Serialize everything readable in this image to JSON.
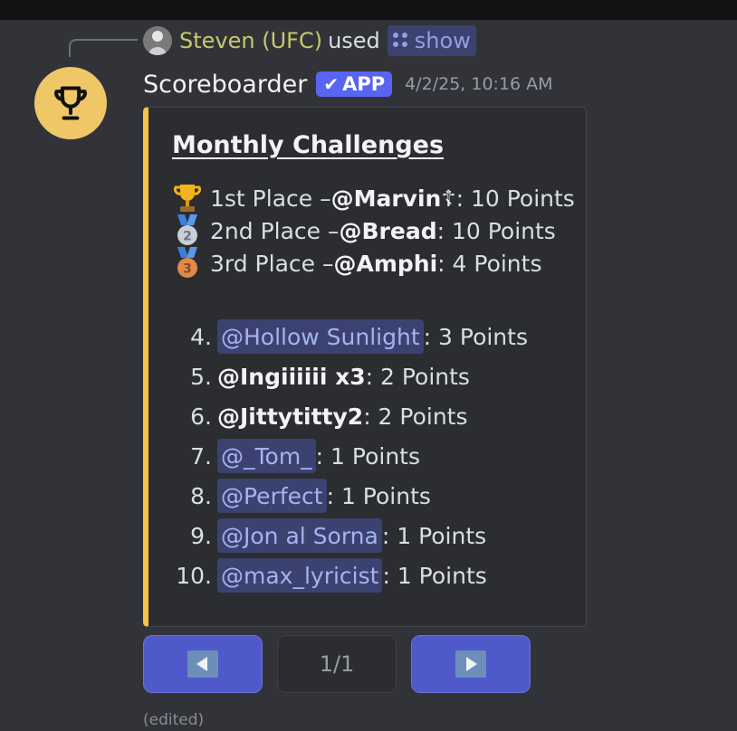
{
  "reply": {
    "user_name": "Steven (UFC)",
    "used_text": "used",
    "command": "show"
  },
  "message": {
    "bot_name": "Scoreboarder",
    "badge": "APP",
    "timestamp": "4/2/25, 10:16 AM",
    "avatar_icon": "trophy-icon",
    "avatar_color": "#f0c767",
    "edited_label": "(edited)"
  },
  "embed": {
    "accent_color": "#f3c445",
    "title": "Monthly Challenges",
    "podium": [
      {
        "medal": "trophy-icon",
        "place": "1st Place – ",
        "user": "@Marvin",
        "user_suffix": "☦",
        "points": ": 10 Points"
      },
      {
        "medal": "second-place-medal-icon",
        "place": "2nd Place – ",
        "user": "@Bread",
        "user_suffix": "",
        "points": ": 10 Points"
      },
      {
        "medal": "third-place-medal-icon",
        "place": "3rd Place – ",
        "user": "@Amphi",
        "user_suffix": "",
        "points": ": 4 Points"
      }
    ],
    "ranks": [
      {
        "num": "4.",
        "user": "@Hollow Sunlight",
        "points": ": 3 Points",
        "style": "mention"
      },
      {
        "num": "5.",
        "user": "@Ingiiiiii x3",
        "points": ": 2 Points",
        "style": "bold"
      },
      {
        "num": "6.",
        "user": "@Jittytitty2",
        "points": ": 2 Points",
        "style": "bold"
      },
      {
        "num": "7.",
        "user": "@_Tom_",
        "points": ": 1 Points",
        "style": "mention"
      },
      {
        "num": "8.",
        "user": "@Perfect",
        "points": ": 1 Points",
        "style": "mention"
      },
      {
        "num": "9.",
        "user": "@Jon al Sorna",
        "points": ": 1 Points",
        "style": "mention"
      },
      {
        "num": "10.",
        "user": "@max_lyricist",
        "points": ": 1 Points",
        "style": "mention"
      }
    ]
  },
  "pagination": {
    "prev_icon": "previous-arrow-icon",
    "page_label": "1/1",
    "next_icon": "next-arrow-icon"
  }
}
